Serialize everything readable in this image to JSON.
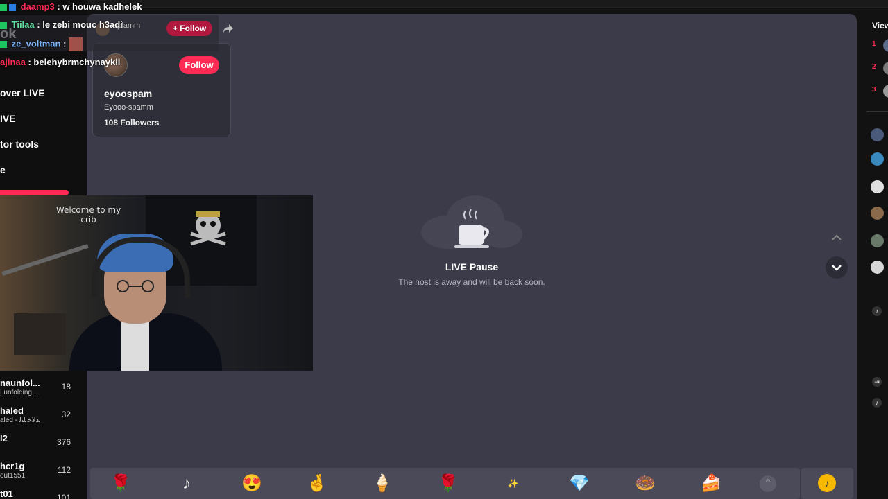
{
  "left_nav": {
    "brand": "ok",
    "items": [
      {
        "label": "over LIVE"
      },
      {
        "label": "IVE"
      },
      {
        "label": "tor tools"
      },
      {
        "label": "e"
      }
    ]
  },
  "chat": [
    {
      "user": "daamp3",
      "message": ": w houwa kadhelek",
      "user_color": "#fe2c55"
    },
    {
      "user": "Tiilaa",
      "message": ": le zebi mouc h3adi",
      "user_color": "#5fe0a4"
    },
    {
      "user": "ze_voltman",
      "message": ":",
      "user_color": "#7fb7ff"
    },
    {
      "user": "ajinaa",
      "message": ": belehybrmchynaykii",
      "user_color": "#fe2c55"
    }
  ],
  "host": {
    "handle": "-splamm",
    "follow_label": "+ Follow"
  },
  "profile_card": {
    "name": "eyoospam",
    "handle": "Eyooo-spamm",
    "followers": "108 Followers",
    "follow_label": "Follow"
  },
  "webcam": {
    "sign_text": "Welcome to my crib"
  },
  "live_pause": {
    "title": "LIVE Pause",
    "subtitle": "The host is away and will be back soon."
  },
  "leaderboard": [
    {
      "name": "naunfol...",
      "sub": "| unfolding ...",
      "count": "18"
    },
    {
      "name": "haled",
      "sub": "aled - ﺪﻟﺎﺧ ﺎﻨﻟ",
      "count": "32"
    },
    {
      "name": "l2",
      "sub": "",
      "count": "376"
    },
    {
      "name": "hcr1g",
      "sub": "out1551",
      "count": "112"
    },
    {
      "name": "t01",
      "sub": "",
      "count": "101"
    }
  ],
  "right_panel": {
    "title": "View",
    "ranks": [
      "1",
      "2",
      "3"
    ]
  },
  "gifts": [
    "rose",
    "tiktok",
    "heart-face",
    "finger-heart",
    "ice-cream",
    "red-rose",
    "2025",
    "diamond",
    "donut",
    "cake"
  ],
  "colors": {
    "accent": "#fe2c55",
    "stage_bg": "#3b3b49",
    "coin": "#f6b800"
  }
}
